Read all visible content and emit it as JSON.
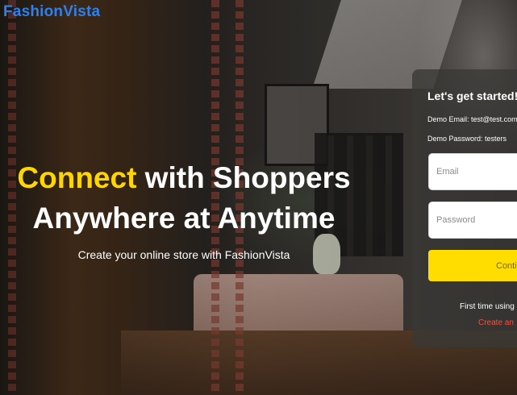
{
  "brand": {
    "name": "FashionVista",
    "color": "#2f80ed"
  },
  "hero": {
    "title_accent": "Connect",
    "title_rest": " with Shoppers",
    "title_line2": "Anywhere at Anytime",
    "subtitle": "Create your online store with FashionVista",
    "accent_color": "#ffd600"
  },
  "login": {
    "heading": "Let's get started!",
    "demo_email": "Demo Email: test@test.com",
    "demo_password": "Demo Password: testers",
    "email_placeholder": "Email",
    "email_value": "",
    "password_placeholder": "Password",
    "password_value": "",
    "continue_label": "Conti",
    "first_time_text": "First time using F",
    "create_link": "Create an",
    "button_color": "#ffdd00",
    "link_color": "#ff4b3a"
  }
}
